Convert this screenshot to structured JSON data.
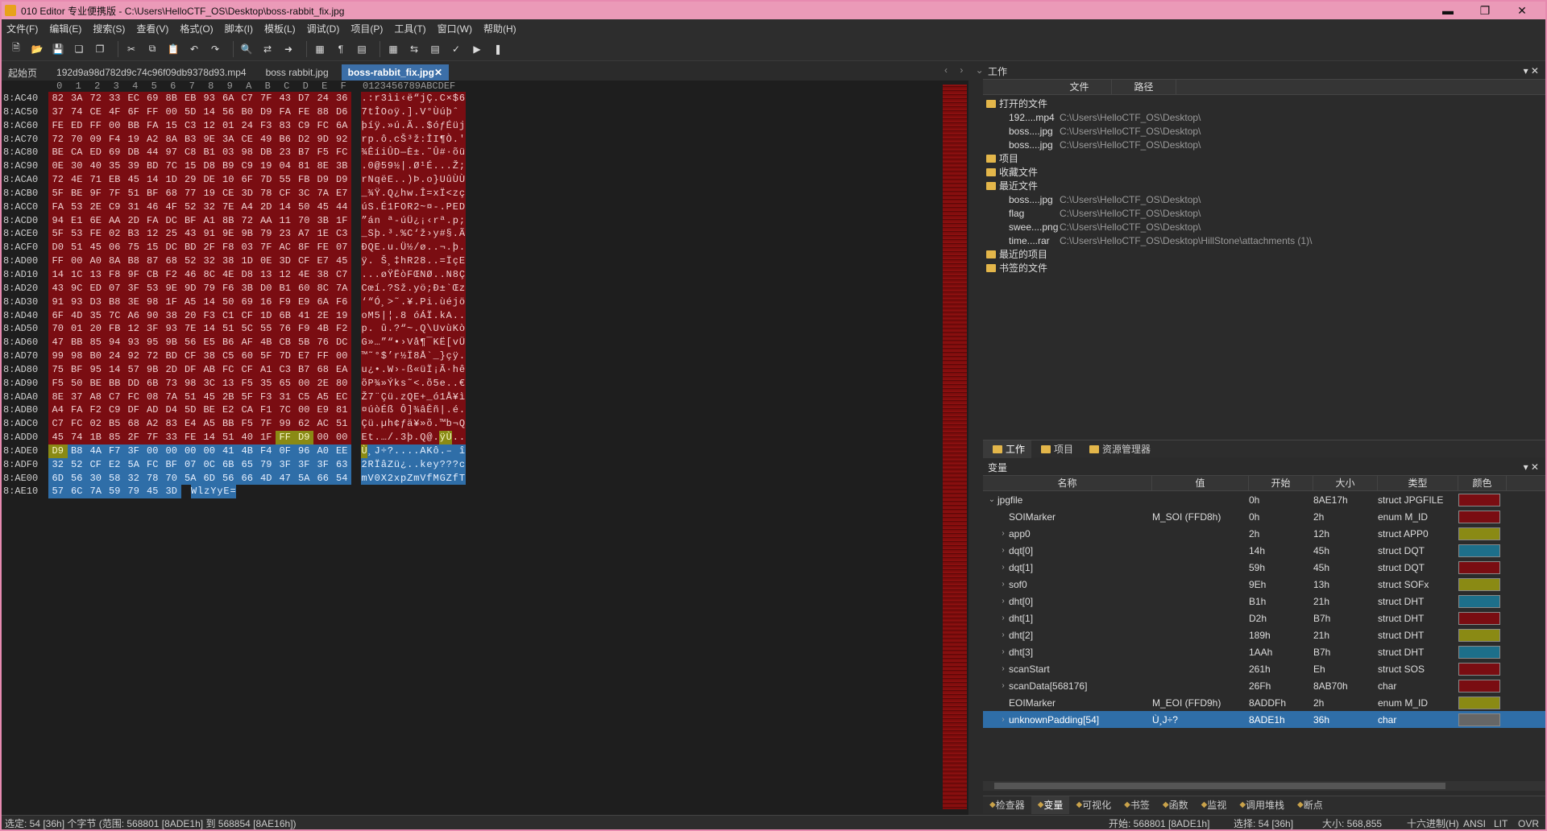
{
  "window": {
    "title": "010 Editor 专业便携版 - C:\\Users\\HelloCTF_OS\\Desktop\\boss-rabbit_fix.jpg"
  },
  "menu": [
    "文件(F)",
    "编辑(E)",
    "搜索(S)",
    "查看(V)",
    "格式(O)",
    "脚本(I)",
    "模板(L)",
    "调试(D)",
    "项目(P)",
    "工具(T)",
    "窗口(W)",
    "帮助(H)"
  ],
  "tabs": [
    "起始页",
    "192d9a98d782d9c74c96f09db9378d93.mp4",
    "boss rabbit.jpg",
    "boss-rabbit_fix.jpg"
  ],
  "hex_header": [
    "0",
    "1",
    "2",
    "3",
    "4",
    "5",
    "6",
    "7",
    "8",
    "9",
    "A",
    "B",
    "C",
    "D",
    "E",
    "F"
  ],
  "ascii_header": "0123456789ABCDEF",
  "hex_rows": [
    {
      "off": "8:AC40",
      "bytes": "82 3A 72 33 EC 69 8B EB 93 6A C7 7F 43 D7 24 36",
      "ascii": ".:r3ìi‹ë“jÇ.C×$6",
      "c": "r"
    },
    {
      "off": "8:AC50",
      "bytes": "37 74 CE 4F 6F FF 00 5D 14 56 B0 D9 FA FE 88 D6",
      "ascii": "7tÎOoÿ.].V°Ùúþˆ Ö",
      "c": "r"
    },
    {
      "off": "8:AC60",
      "bytes": "FE ED FF 00 BB FA 15 C3 12 01 24 F3 83 C9 FC 6A",
      "ascii": "þíÿ.»ú.Ã..$óƒÉüj",
      "c": "r"
    },
    {
      "off": "8:AC70",
      "bytes": "72 70 09 F4 19 A2 8A B3 9E 3A CE 49 B6 D2 9D 92",
      "ascii": "rp.ô.cŠ³ž:ÎI¶Ò.'",
      "c": "r"
    },
    {
      "off": "8:AC80",
      "bytes": "BE CA ED 69 DB 44 97 C8 B1 03 98 DB 23 B7 F5 FC",
      "ascii": "¾ÊíiÛD—È±.˜Û#·õü",
      "c": "r"
    },
    {
      "off": "8:AC90",
      "bytes": "0E 30 40 35 39 BD 7C 15 D8 B9 C9 19 04 81 8E 3B",
      "ascii": ".0@59½|.Ø¹É...Ž;",
      "c": "r"
    },
    {
      "off": "8:ACA0",
      "bytes": "72 4E 71 EB 45 14 1D 29 DE 10 6F 7D 55 FB D9 D9",
      "ascii": "rNqëE..)Þ.o}UûÙÙ",
      "c": "r"
    },
    {
      "off": "8:ACB0",
      "bytes": "5F BE 9F 7F 51 BF 68 77 19 CE 3D 78 CF 3C 7A E7",
      "ascii": "_¾Ÿ.Q¿hw.Î=xÏ<zç",
      "c": "r"
    },
    {
      "off": "8:ACC0",
      "bytes": "FA 53 2E C9 31 46 4F 52 32 7E A4 2D 14 50 45 44",
      "ascii": "úS.É1FOR2~¤-.PED",
      "c": "r"
    },
    {
      "off": "8:ACD0",
      "bytes": "94 E1 6E AA 2D FA DC BF A1 8B 72 AA 11 70 3B 1F",
      "ascii": "”án ª-úÜ¿¡‹rª.p;.",
      "c": "r"
    },
    {
      "off": "8:ACE0",
      "bytes": "5F 53 FE 02 B3 12 25 43 91 9E 9B 79 23 A7 1E C3",
      "ascii": "_Sþ.³.%C‘ž›y#§.Ã",
      "c": "r"
    },
    {
      "off": "8:ACF0",
      "bytes": "D0 51 45 06 75 15 DC BD 2F F8 03 7F AC 8F FE 07",
      "ascii": "ÐQE.u.Ü½/ø..¬.þ.",
      "c": "r"
    },
    {
      "off": "8:AD00",
      "bytes": "FF 00 A0 8A B8 87 68 52 32 38 1D 0E 3D CF E7 45",
      "ascii": "ÿ. Š¸‡hR28..=ÏçE",
      "c": "r"
    },
    {
      "off": "8:AD10",
      "bytes": "14 1C 13 F8 9F CB F2 46 8C 4E D8 13 12 4E 38 C7",
      "ascii": "...øŸËòFŒNØ..N8Ç",
      "c": "r"
    },
    {
      "off": "8:AD20",
      "bytes": "43 9C ED 07 3F 53 9E 9D 79 F6 3B D0 B1 60 8C 7A",
      "ascii": "Cœí.?Sž.yö;Ð±`Œz",
      "c": "r"
    },
    {
      "off": "8:AD30",
      "bytes": "91 93 D3 B8 3E 98 1F A5 14 50 69 16 F9 E9 6A F6",
      "ascii": "‘“Ó¸>˜.¥.Pi.ùéjö",
      "c": "r"
    },
    {
      "off": "8:AD40",
      "bytes": "6F 4D 35 7C A6 90 38 20 F3 C1 CF 1D 6B 41 2E 19",
      "ascii": "oM5|¦.8 óÁÏ.kA..",
      "c": "r"
    },
    {
      "off": "8:AD50",
      "bytes": "70 01 20 FB 12 3F 93 7E 14 51 5C 55 76 F9 4B F2",
      "ascii": "p. û.?“~.Q\\UvùKò",
      "c": "r"
    },
    {
      "off": "8:AD60",
      "bytes": "47 BB 85 94 93 95 9B 56 E5 B6 AF 4B CB 5B 76 DC",
      "ascii": "G»…”“•›Vå¶¯KË[vÜ",
      "c": "r"
    },
    {
      "off": "8:AD70",
      "bytes": "99 98 B0 24 92 72 BD CF 38 C5 60 5F 7D E7 FF 00",
      "ascii": "™˜°$’r½Ï8Å`_}çÿ.",
      "c": "r"
    },
    {
      "off": "8:AD80",
      "bytes": "75 BF 95 14 57 9B 2D DF AB FC CF A1 C3 B7 68 EA",
      "ascii": "u¿•.W›-ß«üÏ¡Ã·hê",
      "c": "r"
    },
    {
      "off": "8:AD90",
      "bytes": "F5 50 BE BB DD 6B 73 98 3C 13 F5 35 65 00 2E 80",
      "ascii": "õP¾»Ýks˜<.õ5e..€",
      "c": "r"
    },
    {
      "off": "8:ADA0",
      "bytes": "8E 37 A8 C7 FC 08 7A 51 45 2B 5F F3 31 C5 A5 EC",
      "ascii": "Ž7¨Çü.zQE+_ó1Å¥ì",
      "c": "r"
    },
    {
      "off": "8:ADB0",
      "bytes": "A4 FA F2 C9 DF AD D4 5D BE E2 CA F1 7C 00 E9 81",
      "ascii": "¤úòÉß­Ô]¾âÊñ|.é.",
      "c": "r"
    },
    {
      "off": "8:ADC0",
      "bytes": "C7 FC 02 B5 68 A2 83 E4 A5 BB F5 7F 99 62 AC 51",
      "ascii": "Çü.µh¢ƒä¥»õ.™b¬Q",
      "c": "r"
    },
    {
      "off": "8:ADD0",
      "bytes": "45 74 1B 85 2F 7F 33 FE 14 51 40 1F FF D9 00 00",
      "ascii": "Et.…/.3þ.Q@.ÿÙ..",
      "c": "ry"
    },
    {
      "off": "8:ADE0",
      "bytes": "D9 B8 4A F7 3F 00 00 00 00 41 4B F4 0F 96 A0 EE",
      "ascii": "Ù¸J÷?....AKô.– î",
      "c": "yb"
    },
    {
      "off": "8:ADF0",
      "bytes": "32 52 CF E2 5A FC BF 07 0C 6B 65 79 3F 3F 3F 63",
      "ascii": "2RÏâZü¿..key???c",
      "c": "b"
    },
    {
      "off": "8:AE00",
      "bytes": "6D 56 30 58 32 78 70 5A 6D 56 66 4D 47 5A 66 54",
      "ascii": "mV0X2xpZmVfMGZfT",
      "c": "b"
    },
    {
      "off": "8:AE10",
      "bytes": "57 6C 7A 59 79 45 3D",
      "ascii": "WlzYyE=",
      "c": "b"
    }
  ],
  "work_panel": {
    "title": "工作",
    "col_file": "文件",
    "col_path": "路径",
    "open_files_label": "打开的文件",
    "open_files": [
      {
        "name": "192....mp4",
        "path": "C:\\Users\\HelloCTF_OS\\Desktop\\"
      },
      {
        "name": "boss....jpg",
        "path": "C:\\Users\\HelloCTF_OS\\Desktop\\"
      },
      {
        "name": "boss....jpg",
        "path": "C:\\Users\\HelloCTF_OS\\Desktop\\"
      }
    ],
    "project_label": "项目",
    "favorites_label": "收藏文件",
    "recent_label": "最近文件",
    "recent_files": [
      {
        "name": "boss....jpg",
        "path": "C:\\Users\\HelloCTF_OS\\Desktop\\"
      },
      {
        "name": "flag",
        "path": "C:\\Users\\HelloCTF_OS\\Desktop\\"
      },
      {
        "name": "swee....png",
        "path": "C:\\Users\\HelloCTF_OS\\Desktop\\"
      },
      {
        "name": "time....rar",
        "path": "C:\\Users\\HelloCTF_OS\\Desktop\\HillStone\\attachments (1)\\"
      }
    ],
    "recent_projects_label": "最近的项目",
    "bookmarks_label": "书签的文件"
  },
  "panel_tabs": [
    "工作",
    "项目",
    "资源管理器"
  ],
  "vars_panel": {
    "title": "变量",
    "headers": [
      "名称",
      "值",
      "开始",
      "大小",
      "类型",
      "颜色"
    ],
    "rows": [
      {
        "name": "jpgfile",
        "value": "",
        "start": "0h",
        "size": "8AE17h",
        "type": "struct JPGFILE",
        "color": "#7a0d12",
        "exp": "v",
        "indent": 0
      },
      {
        "name": "SOIMarker",
        "value": "M_SOI (FFD8h)",
        "start": "0h",
        "size": "2h",
        "type": "enum M_ID",
        "color": "#7a0d12",
        "exp": "",
        "indent": 1
      },
      {
        "name": "app0",
        "value": "",
        "start": "2h",
        "size": "12h",
        "type": "struct APP0",
        "color": "#8a8a14",
        "exp": ">",
        "indent": 1
      },
      {
        "name": "dqt[0]",
        "value": "",
        "start": "14h",
        "size": "45h",
        "type": "struct DQT",
        "color": "#1d6f8a",
        "exp": ">",
        "indent": 1
      },
      {
        "name": "dqt[1]",
        "value": "",
        "start": "59h",
        "size": "45h",
        "type": "struct DQT",
        "color": "#7a0d12",
        "exp": ">",
        "indent": 1
      },
      {
        "name": "sof0",
        "value": "",
        "start": "9Eh",
        "size": "13h",
        "type": "struct SOFx",
        "color": "#8a8a14",
        "exp": ">",
        "indent": 1
      },
      {
        "name": "dht[0]",
        "value": "",
        "start": "B1h",
        "size": "21h",
        "type": "struct DHT",
        "color": "#1d6f8a",
        "exp": ">",
        "indent": 1
      },
      {
        "name": "dht[1]",
        "value": "",
        "start": "D2h",
        "size": "B7h",
        "type": "struct DHT",
        "color": "#7a0d12",
        "exp": ">",
        "indent": 1
      },
      {
        "name": "dht[2]",
        "value": "",
        "start": "189h",
        "size": "21h",
        "type": "struct DHT",
        "color": "#8a8a14",
        "exp": ">",
        "indent": 1
      },
      {
        "name": "dht[3]",
        "value": "",
        "start": "1AAh",
        "size": "B7h",
        "type": "struct DHT",
        "color": "#1d6f8a",
        "exp": ">",
        "indent": 1
      },
      {
        "name": "scanStart",
        "value": "",
        "start": "261h",
        "size": "Eh",
        "type": "struct SOS",
        "color": "#7a0d12",
        "exp": ">",
        "indent": 1
      },
      {
        "name": "scanData[568176]",
        "value": "",
        "start": "26Fh",
        "size": "8AB70h",
        "type": "char",
        "color": "#7a0d12",
        "exp": ">",
        "indent": 1
      },
      {
        "name": "EOIMarker",
        "value": "M_EOI (FFD9h)",
        "start": "8ADDFh",
        "size": "2h",
        "type": "enum M_ID",
        "color": "#8a8a14",
        "exp": "",
        "indent": 1
      },
      {
        "name": "unknownPadding[54]",
        "value": "Ù¸J÷?",
        "start": "8ADE1h",
        "size": "36h",
        "type": "char",
        "color": "#666666",
        "exp": ">",
        "indent": 1,
        "sel": true
      }
    ]
  },
  "bottom_tabs": [
    "检查器",
    "变量",
    "可视化",
    "书签",
    "函数",
    "监视",
    "调用堆栈",
    "断点"
  ],
  "status": {
    "left": "选定: 54 [36h] 个字节 (范围: 568801 [8ADE1h] 到 568854 [8AE16h])",
    "start": "开始: 568801 [8ADE1h]",
    "sel": "选择: 54 [36h]",
    "size": "大小: 568,855",
    "mode": "十六进制(H)",
    "enc": "ANSI",
    "endian": "LIT",
    "ovr": "OVR"
  }
}
